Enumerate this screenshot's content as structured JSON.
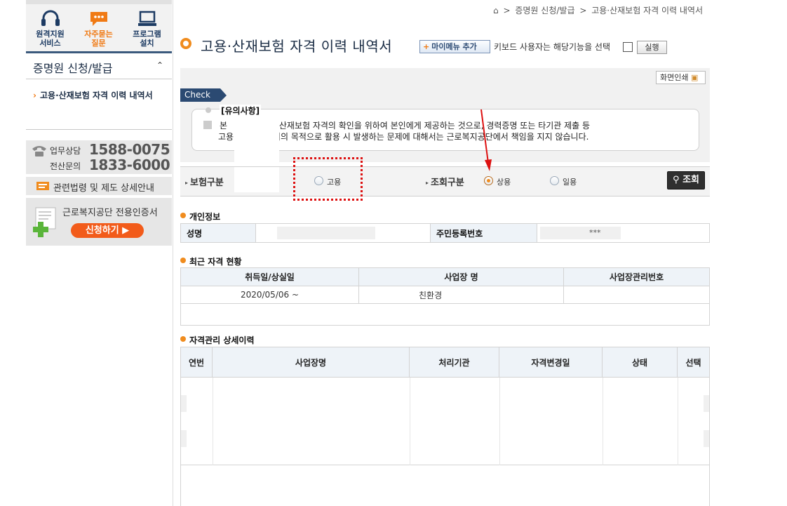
{
  "breadcrumb": {
    "sep": ">",
    "items": [
      "증명원 신청/발급",
      "고용·산재보험 자격 이력 내역서"
    ]
  },
  "quick_menu": [
    {
      "label_line1": "원격지원",
      "label_line2": "서비스",
      "icon": "headset-icon"
    },
    {
      "label_line1": "자주묻는",
      "label_line2": "질문",
      "icon": "chat-bubble-icon",
      "active": true
    },
    {
      "label_line1": "프로그램",
      "label_line2": "설치",
      "icon": "monitor-icon"
    }
  ],
  "sidebar": {
    "section_title": "증명원 신청/발급",
    "active_link": "고용·산재보험 자격 이력 내역서",
    "consult_label": "업무상담",
    "consult_number": "1588-0075",
    "computer_label": "전산문의",
    "computer_number": "1833-6000",
    "law_link": "관련법령 및 제도 상세안내",
    "cert_title": "근로복지공단 전용인증서",
    "cert_button": "신청하기"
  },
  "page": {
    "title": "고용·산재보험 자격 이력 내역서",
    "mymenu_button": "마이메뉴 추가",
    "keyboard_text": "키보드 사용자는 해당기능을 선택",
    "run_button": "실행",
    "print_button": "화면인쇄"
  },
  "notice": {
    "tag": "Check",
    "title": "[유의사항]",
    "line1_a": "본 ",
    "line1_b": "산재보험 자격의 확인을 위하여 본인에게 제공하는 것으로, 경력증명 또는 타기관 제출 등",
    "line2_a": "고용",
    "line2_b": "무 이외의 목적으로 활용 시 발생하는 문제에 대해서는 근로복지공단에서 책임을 지지 않습니다."
  },
  "search": {
    "insurance_label": "보험구분",
    "insurance_option": "고용",
    "query_label": "조회구분",
    "query_options": [
      "상용",
      "일용"
    ],
    "query_selected": "상용",
    "search_button": "조회"
  },
  "personal": {
    "section": "개인정보",
    "name_label": "성명",
    "name_value": "",
    "rrn_label": "주민등록번호",
    "rrn_suffix": "***"
  },
  "recent": {
    "section": "최근 자격 현황",
    "headers": [
      "취득일/상실일",
      "사업장 명",
      "사업장관리번호"
    ],
    "rows": [
      [
        "2020/05/06 ~",
        "친환경",
        ""
      ]
    ]
  },
  "detail": {
    "section": "자격관리 상세이력",
    "headers": [
      "연번",
      "사업장명",
      "처리기관",
      "자격변경일",
      "상태",
      "선택"
    ]
  },
  "colors": {
    "accent": "#f08c1e",
    "navy": "#2b4a72",
    "annotation": "#dd1111"
  }
}
